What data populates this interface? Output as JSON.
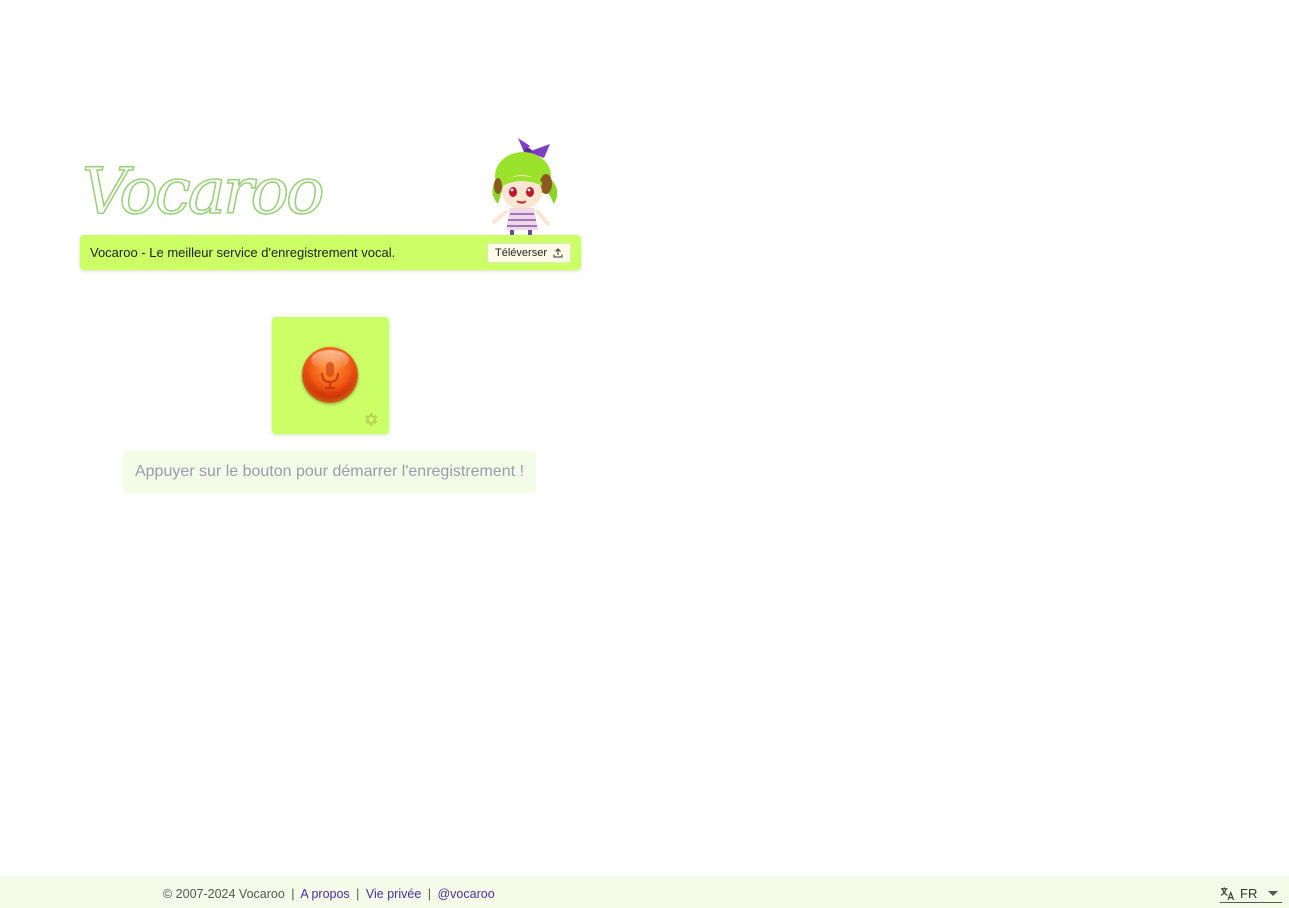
{
  "header": {
    "logo_text": "Vocaroo",
    "tagline": "Vocaroo - Le meilleur service d'enregistrement vocal.",
    "upload_label": "Téléverser"
  },
  "recorder": {
    "hint": "Appuyer sur le bouton pour démarrer l'enregistrement !"
  },
  "footer": {
    "copyright": "© 2007-2024 Vocaroo",
    "links": [
      "A propos",
      "Vie privée",
      "@vocaroo"
    ],
    "separator": "|",
    "language": "FR"
  },
  "colors": {
    "accent": "#ccff66",
    "record_red": "#f15a14",
    "link": "#4b2e9a"
  },
  "icons": [
    "upload-icon",
    "microphone-icon",
    "gear-icon",
    "translate-icon",
    "chevron-down-icon"
  ]
}
